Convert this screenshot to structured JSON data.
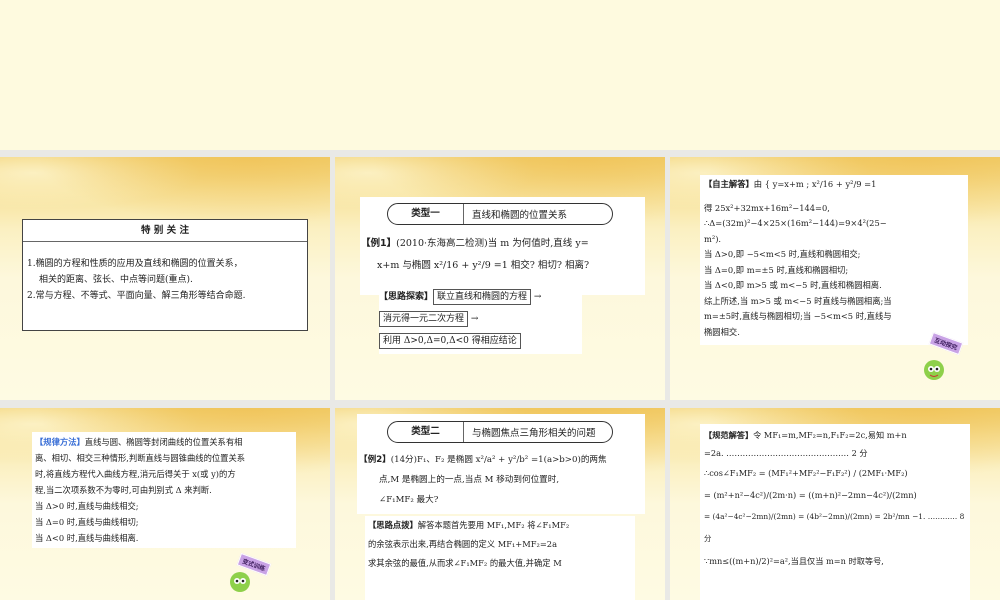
{
  "slides": [
    {
      "title": "特 别 关 注",
      "lines": [
        "1.椭圆的方程和性质的应用及直线和椭圆的位置关系，",
        "相关的距离、弦长、中点等问题(重点).",
        "2.常与方程、不等式、平面向量、解三角形等结合命题."
      ]
    },
    {
      "type_label": "类型一",
      "type_title": "直线和椭圆的位置关系",
      "example_label": "【例1】",
      "example_lines": [
        "(2010·东海高二检测)当 m 为何值时,直线 y=",
        "x+m 与椭圆 x²/16 + y²/9 =1 相交? 相切? 相离?"
      ],
      "hint_label": "【思路探索】",
      "steps": [
        "联立直线和椭圆的方程",
        "消元得一元二次方程",
        "利用 Δ>0,Δ=0,Δ<0 得相应结论"
      ],
      "arrow": "→"
    },
    {
      "label": "【自主解答】",
      "lines": [
        "由 { y=x+m ; x²/16 + y²/9 =1",
        "得 25x²+32mx+16m²−144=0,",
        "∴Δ=(32m)²−4×25×(16m²−144)=9×4²(25−",
        "m²).",
        "当 Δ>0,即 −5<m<5 时,直线和椭圆相交;",
        "当 Δ=0,即 m=±5 时,直线和椭圆相切;",
        "当 Δ<0,即 m>5 或 m<−5 时,直线和椭圆相离.",
        "综上所述,当 m>5 或 m<−5 时直线与椭圆相离;当",
        "m=±5时,直线与椭圆相切;当 −5<m<5 时,直线与",
        "椭圆相交."
      ],
      "sticker": "互动探究"
    },
    {
      "label": "【规律方法】",
      "lines": [
        "直线与圆、椭圆等封闭曲线的位置关系有相",
        "离、相切、相交三种情形,判断直线与圆锥曲线的位置关系",
        "时,将直线方程代入曲线方程,消元后得关于 x(或 y)的方",
        "程,当二次项系数不为零时,可由判别式 Δ 来判断.",
        "当 Δ>0 时,直线与曲线相交;",
        "当 Δ=0 时,直线与曲线相切;",
        "当 Δ<0 时,直线与曲线相离."
      ],
      "sticker": "变式训练"
    },
    {
      "type_label": "类型二",
      "type_title": "与椭圆焦点三角形相关的问题",
      "example_label": "【例2】",
      "example_lines": [
        "(14分)F₁、F₂ 是椭圆 x²/a² + y²/b² =1(a>b>0)的两焦",
        "点,M 是椭圆上的一点,当点 M 移动到何位置时,",
        "∠F₁MF₂ 最大?"
      ],
      "hint_label": "【思路点拨】",
      "hint_lines": [
        "解答本题首先要用 MF₁,MF₂ 将∠F₁MF₂",
        "的余弦表示出来,再结合椭圆的定义 MF₁+MF₂=2a",
        "求其余弦的最值,从而求∠F₁MF₂ 的最大值,并确定 M"
      ]
    },
    {
      "label": "【规范解答】",
      "lines": [
        "令 MF₁=m,MF₂=n,F₁F₂=2c,易知 m+n",
        "=2a. ……………………………………… 2 分",
        "∴cos∠F₁MF₂ = (MF₁²+MF₂²−F₁F₂²) / (2MF₁·MF₂)",
        "= (m²+n²−4c²)/(2m·n) = ((m+n)²−2mn−4c²)/(2mn)",
        "= (4a²−4c²−2mn)/(2mn) = (4b²−2mn)/(2mn) = 2b²/mn −1. ………… 8 分",
        "∵mn≤((m+n)/2)²=a²,当且仅当 m=n 时取等号,"
      ]
    }
  ],
  "colors": {
    "label_blue": "#3a6fd6",
    "gap": "#e9e9e6"
  }
}
